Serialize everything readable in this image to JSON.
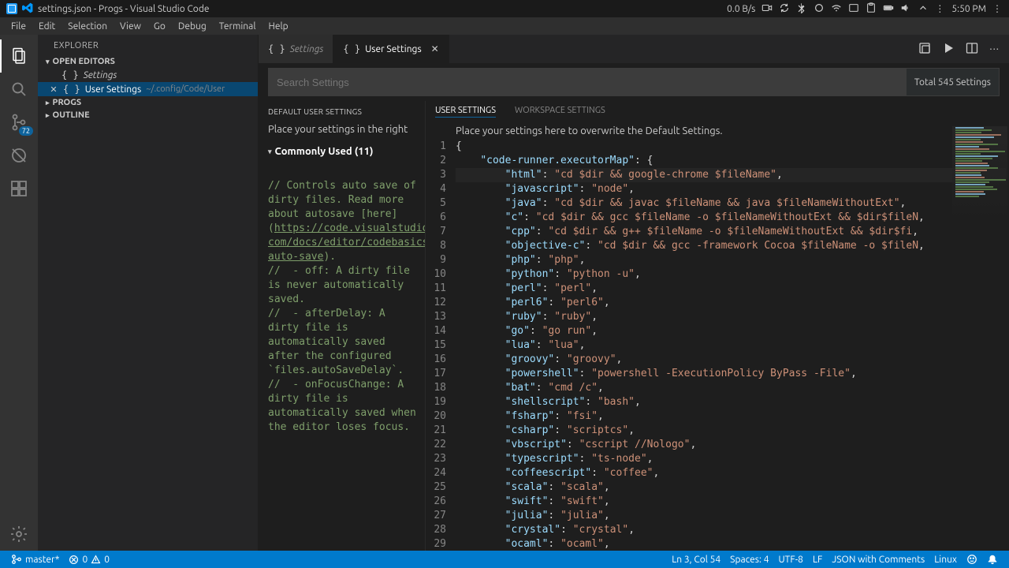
{
  "system": {
    "title": "settings.json - Progs - Visual Studio Code",
    "net_speed": "0.0 B/s",
    "time": "5:50 PM"
  },
  "menubar": [
    "File",
    "Edit",
    "Selection",
    "View",
    "Go",
    "Debug",
    "Terminal",
    "Help"
  ],
  "activity_badge": "72",
  "sidebar": {
    "title": "EXPLORER",
    "open_editors": "OPEN EDITORS",
    "item_settings": "Settings",
    "item_user_settings": "User Settings",
    "item_user_settings_path": "~/.config/Code/User",
    "progs": "PROGS",
    "outline": "OUTLINE"
  },
  "tabs": {
    "t1": "Settings",
    "t2": "User Settings"
  },
  "search": {
    "placeholder": "Search Settings",
    "count": "Total 545 Settings"
  },
  "settings_left": {
    "default_label": "DEFAULT USER SETTINGS",
    "sub": "Place your settings in the right",
    "group": "Commonly Used (11)"
  },
  "settings_right": {
    "tab_user": "USER SETTINGS",
    "tab_workspace": "WORKSPACE SETTINGS",
    "sub": "Place your settings here to overwrite the Default Settings."
  },
  "default_comment": {
    "c1": "// Controls auto save of dirty files. Read more about autosave [here] (",
    "link1": "https://code.visualstudio.",
    "link2": "com/docs/editor/codebasics#_save-auto-save",
    "c1b": ").",
    "c2": "//  - off: A dirty file is never automatically saved.",
    "c3": "//  - afterDelay: A dirty file is automatically saved after the configured `files.autoSaveDelay`.",
    "c4": "//  - onFocusChange: A dirty file is automatically saved when the editor loses focus."
  },
  "code": {
    "key0": "\"code-runner.executorMap\"",
    "lines": [
      {
        "k": "\"html\"",
        "v": "\"cd $dir && google-chrome $fileName\""
      },
      {
        "k": "\"javascript\"",
        "v": "\"node\""
      },
      {
        "k": "\"java\"",
        "v": "\"cd $dir && javac $fileName && java $fileNameWithoutExt\""
      },
      {
        "k": "\"c\"",
        "v": "\"cd $dir && gcc $fileName -o $fileNameWithoutExt && $dir$fileN"
      },
      {
        "k": "\"cpp\"",
        "v": "\"cd $dir && g++ $fileName -o $fileNameWithoutExt && $dir$fi"
      },
      {
        "k": "\"objective-c\"",
        "v": "\"cd $dir && gcc -framework Cocoa $fileName -o $fileN"
      },
      {
        "k": "\"php\"",
        "v": "\"php\""
      },
      {
        "k": "\"python\"",
        "v": "\"python -u\""
      },
      {
        "k": "\"perl\"",
        "v": "\"perl\""
      },
      {
        "k": "\"perl6\"",
        "v": "\"perl6\""
      },
      {
        "k": "\"ruby\"",
        "v": "\"ruby\""
      },
      {
        "k": "\"go\"",
        "v": "\"go run\""
      },
      {
        "k": "\"lua\"",
        "v": "\"lua\""
      },
      {
        "k": "\"groovy\"",
        "v": "\"groovy\""
      },
      {
        "k": "\"powershell\"",
        "v": "\"powershell -ExecutionPolicy ByPass -File\""
      },
      {
        "k": "\"bat\"",
        "v": "\"cmd /c\""
      },
      {
        "k": "\"shellscript\"",
        "v": "\"bash\""
      },
      {
        "k": "\"fsharp\"",
        "v": "\"fsi\""
      },
      {
        "k": "\"csharp\"",
        "v": "\"scriptcs\""
      },
      {
        "k": "\"vbscript\"",
        "v": "\"cscript //Nologo\""
      },
      {
        "k": "\"typescript\"",
        "v": "\"ts-node\""
      },
      {
        "k": "\"coffeescript\"",
        "v": "\"coffee\""
      },
      {
        "k": "\"scala\"",
        "v": "\"scala\""
      },
      {
        "k": "\"swift\"",
        "v": "\"swift\""
      },
      {
        "k": "\"julia\"",
        "v": "\"julia\""
      },
      {
        "k": "\"crystal\"",
        "v": "\"crystal\""
      },
      {
        "k": "\"ocaml\"",
        "v": "\"ocaml\""
      }
    ]
  },
  "status": {
    "branch": "master*",
    "errors": "0",
    "warnings": "0",
    "cursor": "Ln 3, Col 54",
    "spaces": "Spaces: 4",
    "encoding": "UTF-8",
    "eol": "LF",
    "lang": "JSON with Comments",
    "os": "Linux"
  }
}
